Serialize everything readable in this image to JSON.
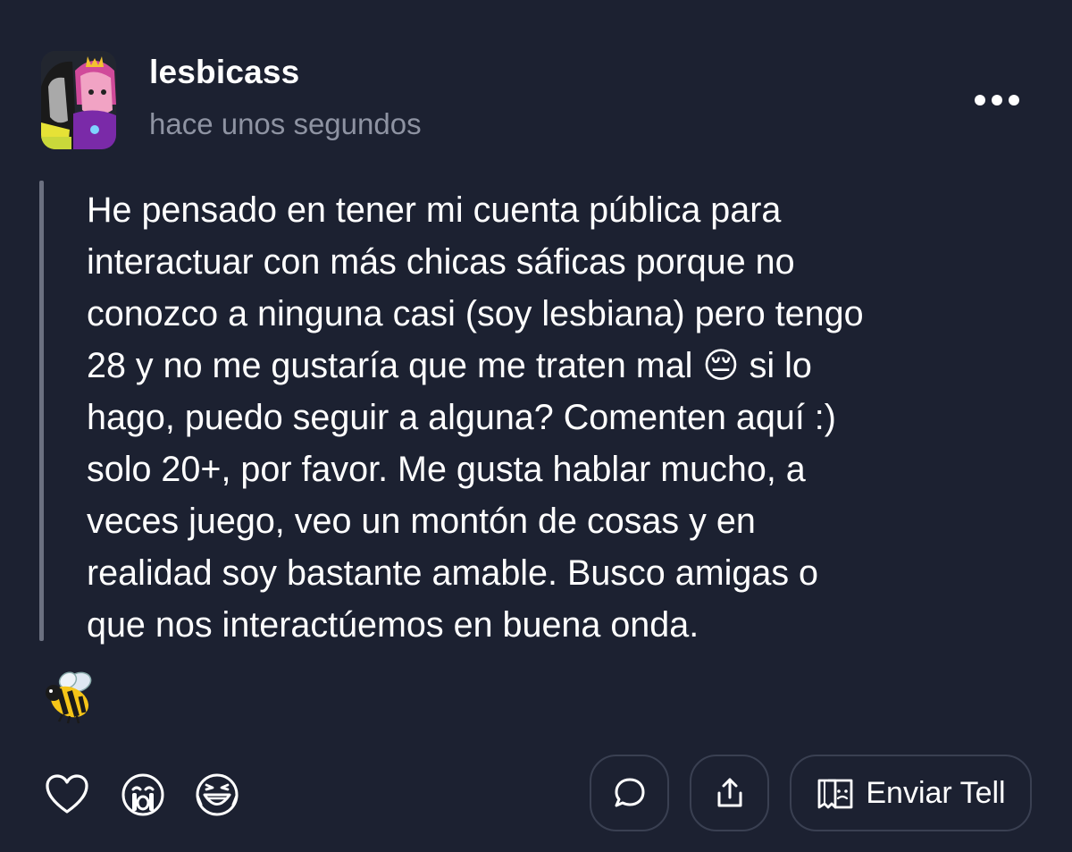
{
  "post": {
    "username": "lesbicass",
    "timestamp": "hace unos segundos",
    "message": "He pensado en tener mi cuenta pública para\ninteractuar con más chicas sáficas porque no\nconozco a ninguna casi (soy lesbiana) pero tengo\n28 y no me gustaría que me traten mal 😔 si lo\nhago, puedo seguir a alguna? Comenten aquí :)\nsolo 20+, por favor. Me gusta hablar mucho, a\nveces juego, veo un montón de cosas y en\nrealidad soy bastante amable. Busco amigas o\nque nos interactúemos en buena onda.",
    "reaction_emoji": "bee-emoji"
  },
  "actions": {
    "icons": [
      "heart-icon",
      "crying-face-icon",
      "laughing-face-icon",
      "comment-icon",
      "share-icon",
      "tell-icon"
    ],
    "send_tell_label": "Enviar Tell"
  },
  "colors": {
    "background": "#1c2131",
    "text": "#ffffff",
    "muted": "#8e93a2",
    "border": "#3a4052",
    "quote_bar": "#6b7080"
  }
}
